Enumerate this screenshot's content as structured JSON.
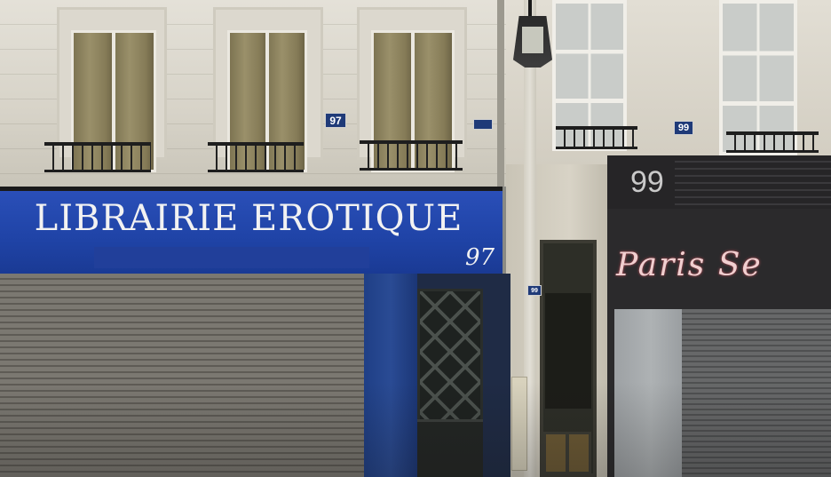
{
  "scene": {
    "left_shop_sign": "LIBRAIRIE EROTIQUE",
    "left_shop_number": "97",
    "upper_plaque_number": "97",
    "right_shop_number": "99",
    "right_plaque_number": "99",
    "door_plaque_number": "99",
    "right_shop_sign": "Paris Se",
    "colors": {
      "sign_blue": "#1f43a6",
      "facade_stone": "#dcd8ce",
      "shutter_grey": "#6f6c66",
      "right_shop_dark": "#2b2a2c",
      "neon_pink": "#f0cfd0"
    }
  }
}
